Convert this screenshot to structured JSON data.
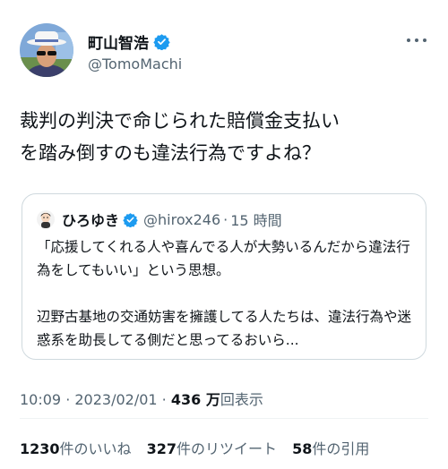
{
  "author": {
    "name": "町山智浩",
    "handle": "@TomoMachi",
    "avatar_icon": "avatar-man-in-hat",
    "verified_color": "#1d9bf0"
  },
  "more_icon": "ellipsis-icon",
  "tweet": {
    "text": "裁判の判決で命じられた賠償金支払い\nを踏み倒すのも違法行為ですよね？"
  },
  "quote": {
    "name": "ひろゆき",
    "handle": "@hirox246",
    "separator": "·",
    "time": "15 時間",
    "text": "「応援してくれる人や喜んでる人が大勢いるんだから違法行為をしてもいい」という思想。\n\n辺野古基地の交通妨害を擁護してる人たちは、違法行為や迷惑系を助長してる側だと思ってるおいら..."
  },
  "meta": {
    "time": "10:09",
    "separator": " · ",
    "date": "2023/02/01",
    "views_count": "436 万",
    "views_label": "回表示"
  },
  "stats": [
    {
      "count": "1230",
      "label": "件のいいね"
    },
    {
      "count": "327",
      "label": "件のリツイート"
    },
    {
      "count": "58",
      "label": "件の引用"
    }
  ]
}
